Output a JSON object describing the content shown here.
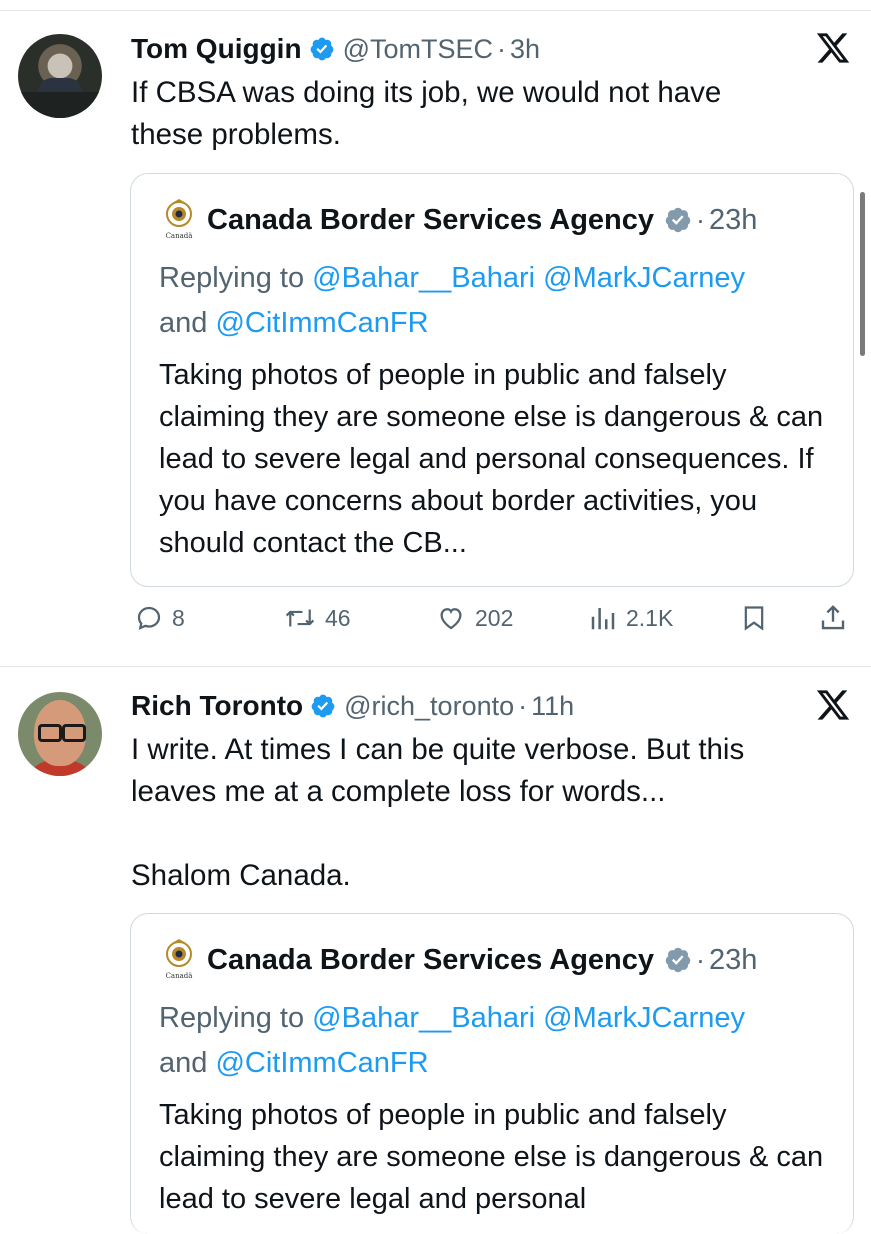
{
  "tweets": [
    {
      "author": "Tom Quiggin",
      "handle": "@TomTSEC",
      "dot": "·",
      "time": "3h",
      "text": "If CBSA was doing its job, we would not have\nthese problems.",
      "quote": {
        "author": "Canada Border Services Agency",
        "dot": "·",
        "time": "23h",
        "replying_prefix": "Replying to ",
        "mention_1": "@Bahar__Bahari",
        "mention_2": "@MarkJCarney",
        "and": "and ",
        "mention_3": "@CitImmCanFR",
        "text": "Taking photos of people in public and falsely claiming they are someone else is dangerous & can lead to severe legal and personal consequences. If you have concerns about border activities, you should contact the CB..."
      },
      "actions": {
        "replies": "8",
        "reposts": "46",
        "likes": "202",
        "views": "2.1K"
      }
    },
    {
      "author": "Rich Toronto",
      "handle": "@rich_toronto",
      "dot": "·",
      "time": "11h",
      "text": "I write. At times I can be quite verbose.  But this\nleaves me at a complete loss for words...\n\nShalom Canada.",
      "quote": {
        "author": "Canada Border Services Agency",
        "dot": "·",
        "time": "23h",
        "replying_prefix": "Replying to ",
        "mention_1": "@Bahar__Bahari",
        "mention_2": "@MarkJCarney",
        "and": "and ",
        "mention_3": "@CitImmCanFR",
        "text": "Taking photos of people in public and falsely claiming they are someone else is dangerous & can lead to severe legal and personal"
      }
    }
  ],
  "icons": {
    "verified": "verified-badge-icon",
    "x_logo": "x-logo-icon",
    "reply": "reply-icon",
    "repost": "repost-icon",
    "like": "like-icon",
    "views": "views-icon",
    "bookmark": "bookmark-icon",
    "share": "share-icon"
  },
  "colors": {
    "accent": "#1d9bf0",
    "secondary_text": "#536471",
    "verified_personal": "#1d9bf0",
    "verified_gov": "#829aab"
  }
}
